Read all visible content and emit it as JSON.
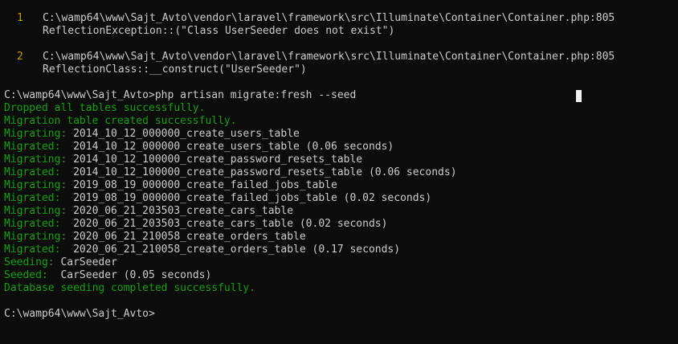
{
  "trace": [
    {
      "number": "1",
      "location": "C:\\wamp64\\www\\Sajt_Avto\\vendor\\laravel\\framework\\src\\Illuminate\\Container\\Container.php:805",
      "call": "ReflectionException::(\"Class UserSeeder does not exist\")"
    },
    {
      "number": "2",
      "location": "C:\\wamp64\\www\\Sajt_Avto\\vendor\\laravel\\framework\\src\\Illuminate\\Container\\Container.php:805",
      "call": "ReflectionClass::__construct(\"UserSeeder\")"
    }
  ],
  "command": {
    "prompt": "C:\\wamp64\\www\\Sajt_Avto>",
    "text": "php artisan migrate:fresh --seed"
  },
  "output": [
    {
      "label": "Dropped all tables successfully.",
      "value": ""
    },
    {
      "label": "Migration table created successfully.",
      "value": ""
    },
    {
      "label": "Migrating: ",
      "value": "2014_10_12_000000_create_users_table"
    },
    {
      "label": "Migrated:  ",
      "value": "2014_10_12_000000_create_users_table (0.06 seconds)"
    },
    {
      "label": "Migrating: ",
      "value": "2014_10_12_100000_create_password_resets_table"
    },
    {
      "label": "Migrated:  ",
      "value": "2014_10_12_100000_create_password_resets_table (0.06 seconds)"
    },
    {
      "label": "Migrating: ",
      "value": "2019_08_19_000000_create_failed_jobs_table"
    },
    {
      "label": "Migrated:  ",
      "value": "2019_08_19_000000_create_failed_jobs_table (0.02 seconds)"
    },
    {
      "label": "Migrating: ",
      "value": "2020_06_21_203503_create_cars_table"
    },
    {
      "label": "Migrated:  ",
      "value": "2020_06_21_203503_create_cars_table (0.02 seconds)"
    },
    {
      "label": "Migrating: ",
      "value": "2020_06_21_210058_create_orders_table"
    },
    {
      "label": "Migrated:  ",
      "value": "2020_06_21_210058_create_orders_table (0.17 seconds)"
    },
    {
      "label": "Seeding: ",
      "value": "CarSeeder"
    },
    {
      "label": "Seeded:  ",
      "value": "CarSeeder (0.05 seconds)"
    },
    {
      "label": "Database seeding completed successfully.",
      "value": ""
    }
  ],
  "final_prompt": "C:\\wamp64\\www\\Sajt_Avto>",
  "colors": {
    "background": "#0c0c0c",
    "text": "#cccccc",
    "success": "#13a10e",
    "trace_number": "#c19c00",
    "cursor": "#f2f2f2"
  }
}
